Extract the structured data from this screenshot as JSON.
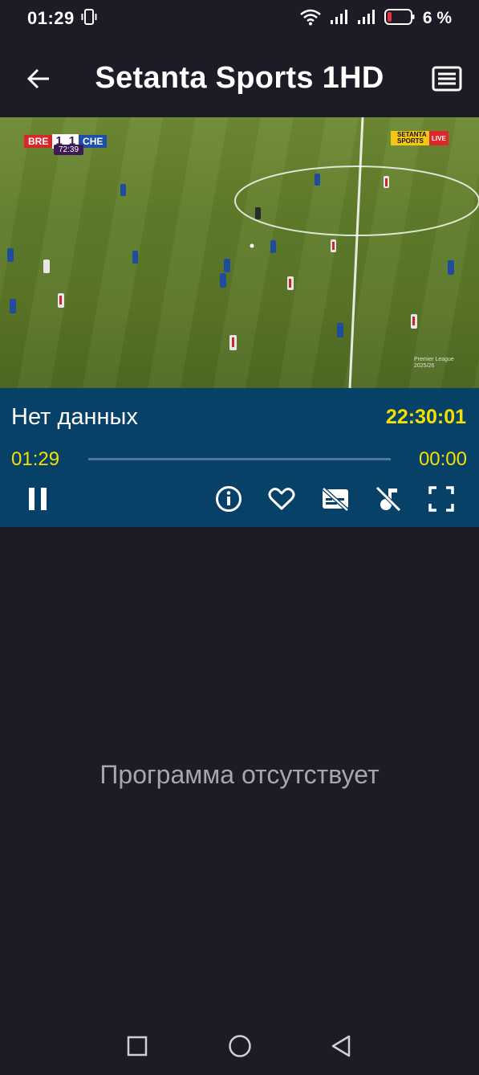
{
  "status_bar": {
    "time": "01:29",
    "battery_text": "6 %",
    "icons": [
      "vibrate-icon",
      "wifi-icon",
      "signal-icon",
      "signal-icon",
      "battery-icon"
    ]
  },
  "app_bar": {
    "title": "Setanta Sports 1HD",
    "back_icon": "arrow-left-icon",
    "menu_icon": "list-icon"
  },
  "video": {
    "scorebug": {
      "home": "BRE",
      "home_score": "1",
      "away_score": "1",
      "away": "CHE",
      "clock": "72:39"
    },
    "broadcaster_logo": {
      "line1": "SETANTA",
      "line2": "SPORTS",
      "live": "LIVE"
    },
    "watermark": {
      "line1": "Premier League",
      "line2": "2025/26"
    }
  },
  "player": {
    "program_name": "Нет данных",
    "clock": "22:30:01",
    "elapsed": "01:29",
    "remaining": "00:00",
    "progress": 0,
    "controls": [
      "pause-icon",
      "info-icon",
      "favorite-icon",
      "subtitles-off-icon",
      "audio-off-icon",
      "fullscreen-icon"
    ]
  },
  "schedule": {
    "empty_message": "Программа отсутствует"
  },
  "nav_bar": {
    "icons": [
      "recents-square-icon",
      "home-circle-icon",
      "back-triangle-icon"
    ]
  },
  "colors": {
    "background": "#1d1c26",
    "panel": "#074167",
    "accent_yellow": "#f4e000",
    "muted_text": "#a6a6ad"
  }
}
